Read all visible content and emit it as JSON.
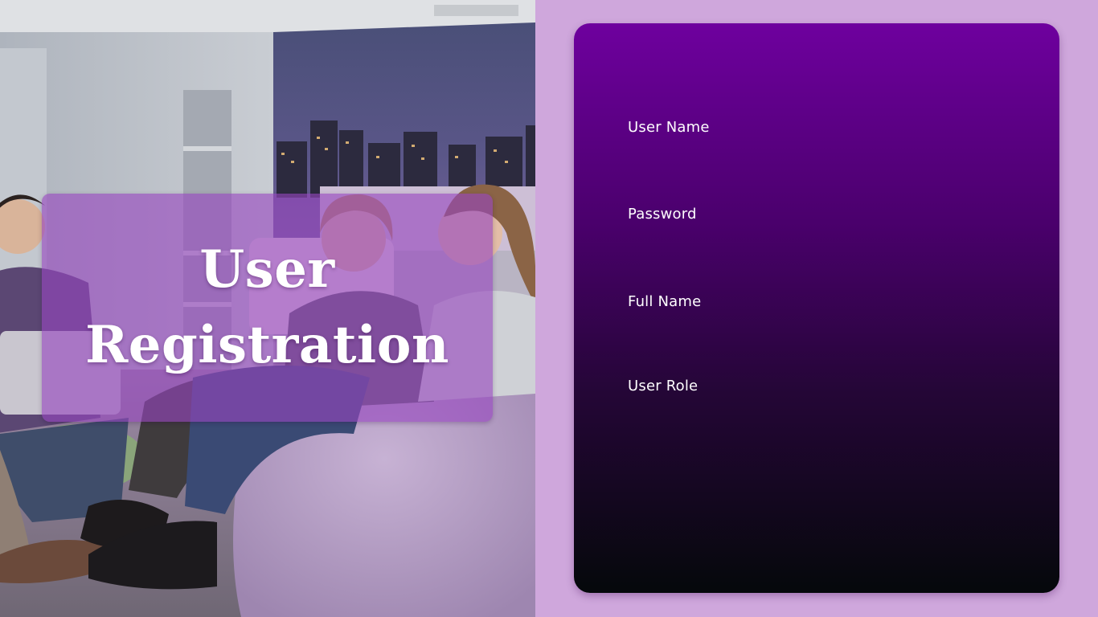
{
  "hero": {
    "title_line1": "User",
    "title_line2": "Registration"
  },
  "form": {
    "fields": [
      {
        "label": "User Name",
        "value": ""
      },
      {
        "label": "Password",
        "value": ""
      },
      {
        "label": "Full Name",
        "value": ""
      },
      {
        "label": "User Role",
        "value": ""
      }
    ]
  },
  "colors": {
    "page_background": "#cfa7dc",
    "title_card": "#9646be",
    "form_gradient_top": "#6e009e",
    "form_gradient_bottom": "#05080b",
    "text": "#ffffff"
  }
}
